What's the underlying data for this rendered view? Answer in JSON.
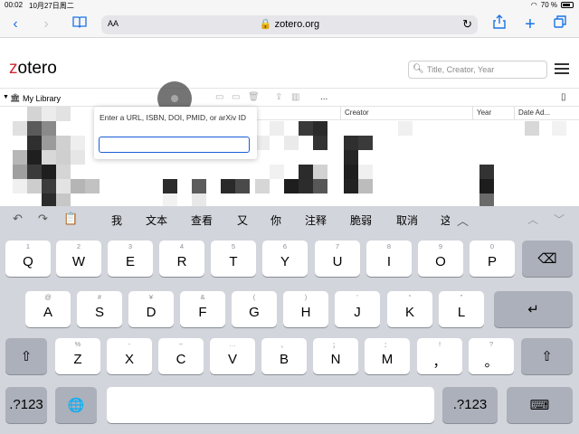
{
  "status_bar": {
    "time": "00:02",
    "date": "10月27日周二",
    "battery": "70 %"
  },
  "browser": {
    "aa_label": "AA",
    "url": "zotero.org",
    "icons": {
      "back": "chevron-left-icon",
      "forward": "chevron-right-icon",
      "bookmarks": "book-icon",
      "lock": "lock-icon",
      "reload": "reload-icon",
      "share": "share-icon",
      "new_tab": "plus-icon",
      "tabs": "tabs-icon"
    }
  },
  "zotero": {
    "logo_z": "z",
    "logo_rest": "otero",
    "search_placeholder": "Title, Creator, Year",
    "library_label": "My Library",
    "columns": {
      "creator": "Creator",
      "year": "Year",
      "date_added": "Date Ad..."
    },
    "more_label": "..."
  },
  "popover": {
    "label": "Enter a URL, ISBN, DOI, PMID, or arXiv ID",
    "value": ""
  },
  "keyboard": {
    "candidates": [
      "我",
      "文本",
      "查看",
      "又",
      "你",
      "注释",
      "脆弱",
      "取消",
      "这"
    ],
    "row1": [
      {
        "hint": "1",
        "main": "Q"
      },
      {
        "hint": "2",
        "main": "W"
      },
      {
        "hint": "3",
        "main": "E"
      },
      {
        "hint": "4",
        "main": "R"
      },
      {
        "hint": "5",
        "main": "T"
      },
      {
        "hint": "6",
        "main": "Y"
      },
      {
        "hint": "7",
        "main": "U"
      },
      {
        "hint": "8",
        "main": "I"
      },
      {
        "hint": "9",
        "main": "O"
      },
      {
        "hint": "0",
        "main": "P"
      }
    ],
    "row2": [
      {
        "hint": "@",
        "main": "A"
      },
      {
        "hint": "#",
        "main": "S"
      },
      {
        "hint": "¥",
        "main": "D"
      },
      {
        "hint": "&",
        "main": "F"
      },
      {
        "hint": "(",
        "main": "G"
      },
      {
        "hint": ")",
        "main": "H"
      },
      {
        "hint": "'",
        "main": "J"
      },
      {
        "hint": "“",
        "main": "K"
      },
      {
        "hint": "”",
        "main": "L"
      }
    ],
    "row3": [
      {
        "hint": "%",
        "main": "Z"
      },
      {
        "hint": "-",
        "main": "X"
      },
      {
        "hint": "~",
        "main": "C"
      },
      {
        "hint": "…",
        "main": "V"
      },
      {
        "hint": "、",
        "main": "B"
      },
      {
        "hint": "；",
        "main": "N"
      },
      {
        "hint": "：",
        "main": "M"
      },
      {
        "hint": "!",
        "main": "，"
      },
      {
        "hint": "?",
        "main": "。"
      }
    ],
    "numbers_label": ".?123",
    "delete_symbol": "⌫",
    "return_symbol": "↵",
    "shift_symbol": "⇧",
    "globe_symbol": "🌐",
    "undo_symbol": "↶",
    "redo_symbol": "↷",
    "paste_symbol": "📋",
    "collapse_symbol": "︿",
    "hide_keyboard_symbol": "⌨"
  }
}
